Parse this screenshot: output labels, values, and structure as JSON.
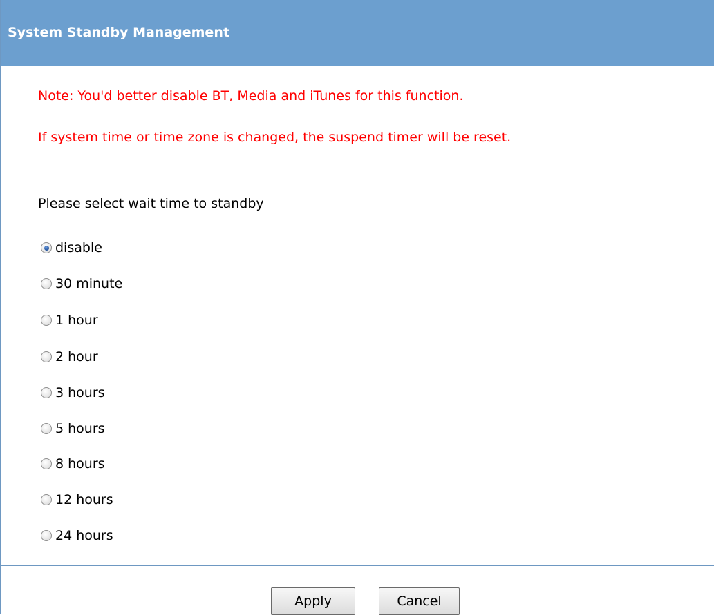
{
  "header": {
    "title": "System Standby Management"
  },
  "notes": [
    "Note: You'd better disable BT, Media and iTunes for this function.",
    "If system time or time zone is changed, the suspend timer will be reset."
  ],
  "prompt": "Please select wait time to standby",
  "standby_options": [
    {
      "label": "disable",
      "selected": true
    },
    {
      "label": "30 minute",
      "selected": false
    },
    {
      "label": "1 hour",
      "selected": false
    },
    {
      "label": "2 hour",
      "selected": false
    },
    {
      "label": "3 hours",
      "selected": false
    },
    {
      "label": "5 hours",
      "selected": false
    },
    {
      "label": "8 hours",
      "selected": false
    },
    {
      "label": "12 hours",
      "selected": false
    },
    {
      "label": "24 hours",
      "selected": false
    }
  ],
  "buttons": {
    "apply_label": "Apply",
    "cancel_label": "Cancel"
  },
  "colors": {
    "header_bg": "#6c9fcf",
    "note_text": "#ff0000",
    "border": "#6e98c2"
  }
}
